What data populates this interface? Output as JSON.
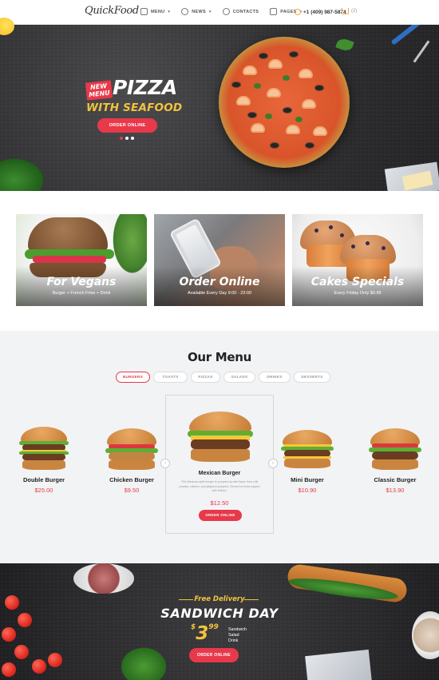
{
  "header": {
    "logo": "QuickFood",
    "nav": [
      {
        "label": "MENU",
        "icon": "chef-hat-icon",
        "has_dropdown": true
      },
      {
        "label": "NEWS",
        "icon": "tag-icon",
        "has_dropdown": true
      },
      {
        "label": "CONTACTS",
        "icon": "user-icon",
        "has_dropdown": false
      },
      {
        "label": "PAGES",
        "icon": "layers-icon",
        "has_dropdown": true
      }
    ],
    "phone": "+1 (409) 987-5874",
    "cart_count": "(2)"
  },
  "hero": {
    "badge": "NEW MENU",
    "badge_line1": "NEW",
    "badge_line2": "MENU",
    "title": "PIZZA",
    "subtitle": "WITH SEAFOOD",
    "button": "ORDER ONLINE",
    "slides": 3,
    "active_slide": 1
  },
  "promos": [
    {
      "title": "For Vegans",
      "subtitle": "Burger + French Fries + Drink"
    },
    {
      "title": "Order Online",
      "subtitle": "Available Every Day 9:00 - 23:00"
    },
    {
      "title": "Cakes Specials",
      "subtitle": "Every Friday Only $0.99"
    }
  ],
  "menu": {
    "title": "Our Menu",
    "filters": [
      "BURGERS",
      "TOASTS",
      "PIZZAS",
      "SALADS",
      "DRINKS",
      "DESSERTS"
    ],
    "active_filter": "BURGERS",
    "items": [
      {
        "name": "Double Burger",
        "price": "$25.00"
      },
      {
        "name": "Chicken Burger",
        "price": "$9.50"
      },
      {
        "name": "Mini Burger",
        "price": "$10.90"
      },
      {
        "name": "Classic Burger",
        "price": "$13.90"
      }
    ],
    "featured": {
      "name": "Mexican Burger",
      "description": "This Mexican-style burger is pumped up with flavor from chili powder, cilantro, and jalapeno peppers. Served on buns topped with lettuce.",
      "price": "$12.50",
      "button": "ORDER ONLINE"
    }
  },
  "sandwich_promo": {
    "tagline": "Free Delivery",
    "title": "SANDWICH DAY",
    "currency": "$",
    "price": "3",
    "price_cents": "99",
    "includes": [
      "Sandwich",
      "Salad",
      "Drink"
    ],
    "button": "ORDER ONLINE"
  },
  "colors": {
    "accent": "#e8394a",
    "yellow": "#f3c23e",
    "dark_bg": "#2f2f31",
    "light_bg": "#f2f3f5"
  }
}
